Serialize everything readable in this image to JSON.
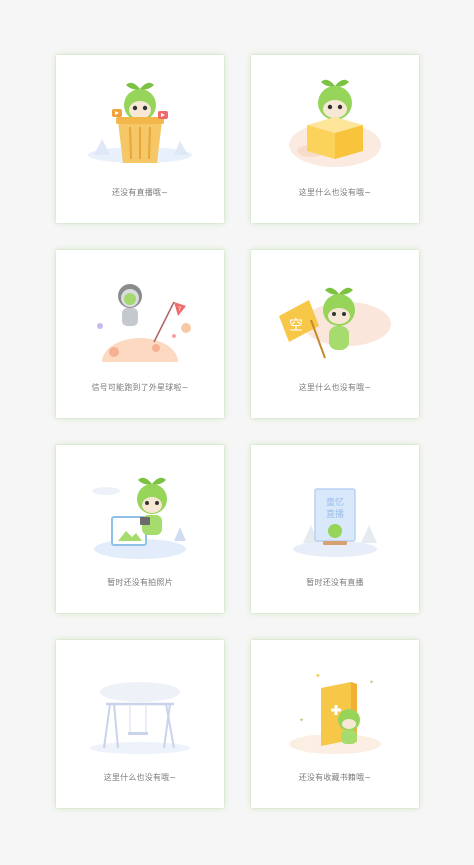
{
  "colors": {
    "background": "#f6f6f6",
    "card": "#ffffff",
    "mascot_green": "#8fcf4f",
    "caption_text": "#7a7a7a"
  },
  "cards": [
    {
      "caption": "还没有直播哦~"
    },
    {
      "caption": "这里什么也没有哦~"
    },
    {
      "caption": "信号可能跑到了外星球啦~"
    },
    {
      "caption": "这里什么也没有哦~"
    },
    {
      "caption": "暂时还没有拍照片"
    },
    {
      "caption": "暂时还没有直播"
    },
    {
      "caption": "这里什么也没有哦~"
    },
    {
      "caption": "还没有收藏书籍哦~"
    }
  ],
  "illustrations": [
    {
      "icon": "mascot-in-trash-bin-icon"
    },
    {
      "icon": "mascot-in-box-icon"
    },
    {
      "icon": "astronaut-planet-icon"
    },
    {
      "icon": "mascot-holding-sign-icon",
      "sign_text": "空"
    },
    {
      "icon": "mascot-camera-icon"
    },
    {
      "icon": "mascot-live-screen-icon",
      "screen_text": [
        "童忆",
        "直播"
      ]
    },
    {
      "icon": "empty-swing-icon"
    },
    {
      "icon": "mascot-book-icon"
    }
  ]
}
